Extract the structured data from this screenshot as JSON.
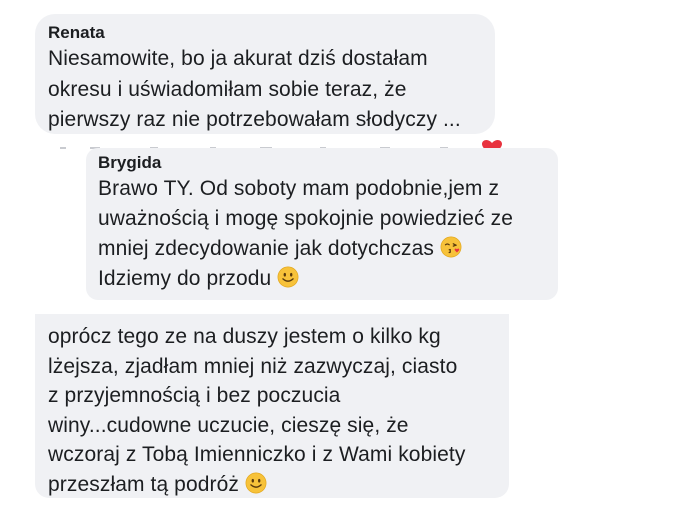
{
  "messages": [
    {
      "sender": "Renata",
      "lines": [
        "Niesamowite, bo ja akurat dziś dostałam",
        "okresu i uświadomiłam sobie teraz, że",
        "pierwszy raz nie potrzebowałam słodyczy ..."
      ]
    },
    {
      "sender": "Brygida",
      "lines": [
        "Brawo TY. Od soboty mam podobnie,jem z",
        "uważnością i mogę spokojnie powiedzieć ze",
        "mniej zdecydowanie jak dotychczas",
        "Idziemy do przodu"
      ],
      "emojis": [
        "kiss-face-emoji",
        "smile-face-emoji"
      ]
    },
    {
      "lines": [
        "oprócz tego ze na duszy jestem o kilko kg",
        "lżejsza, zjadłam mniej niż zazwyczaj, ciasto",
        "z przyjemnością i bez poczucia",
        "winy...cudowne uczucie, cieszę się, że",
        "wczoraj z Tobą Imienniczko i z Wami kobiety",
        "przeszłam tą podróż"
      ],
      "emojis": [
        "smile-face-emoji"
      ]
    }
  ],
  "reaction": "heart-icon",
  "colors": {
    "bubble": "#f0f1f4",
    "text": "#1c1e21",
    "heart": "#e8323e"
  }
}
